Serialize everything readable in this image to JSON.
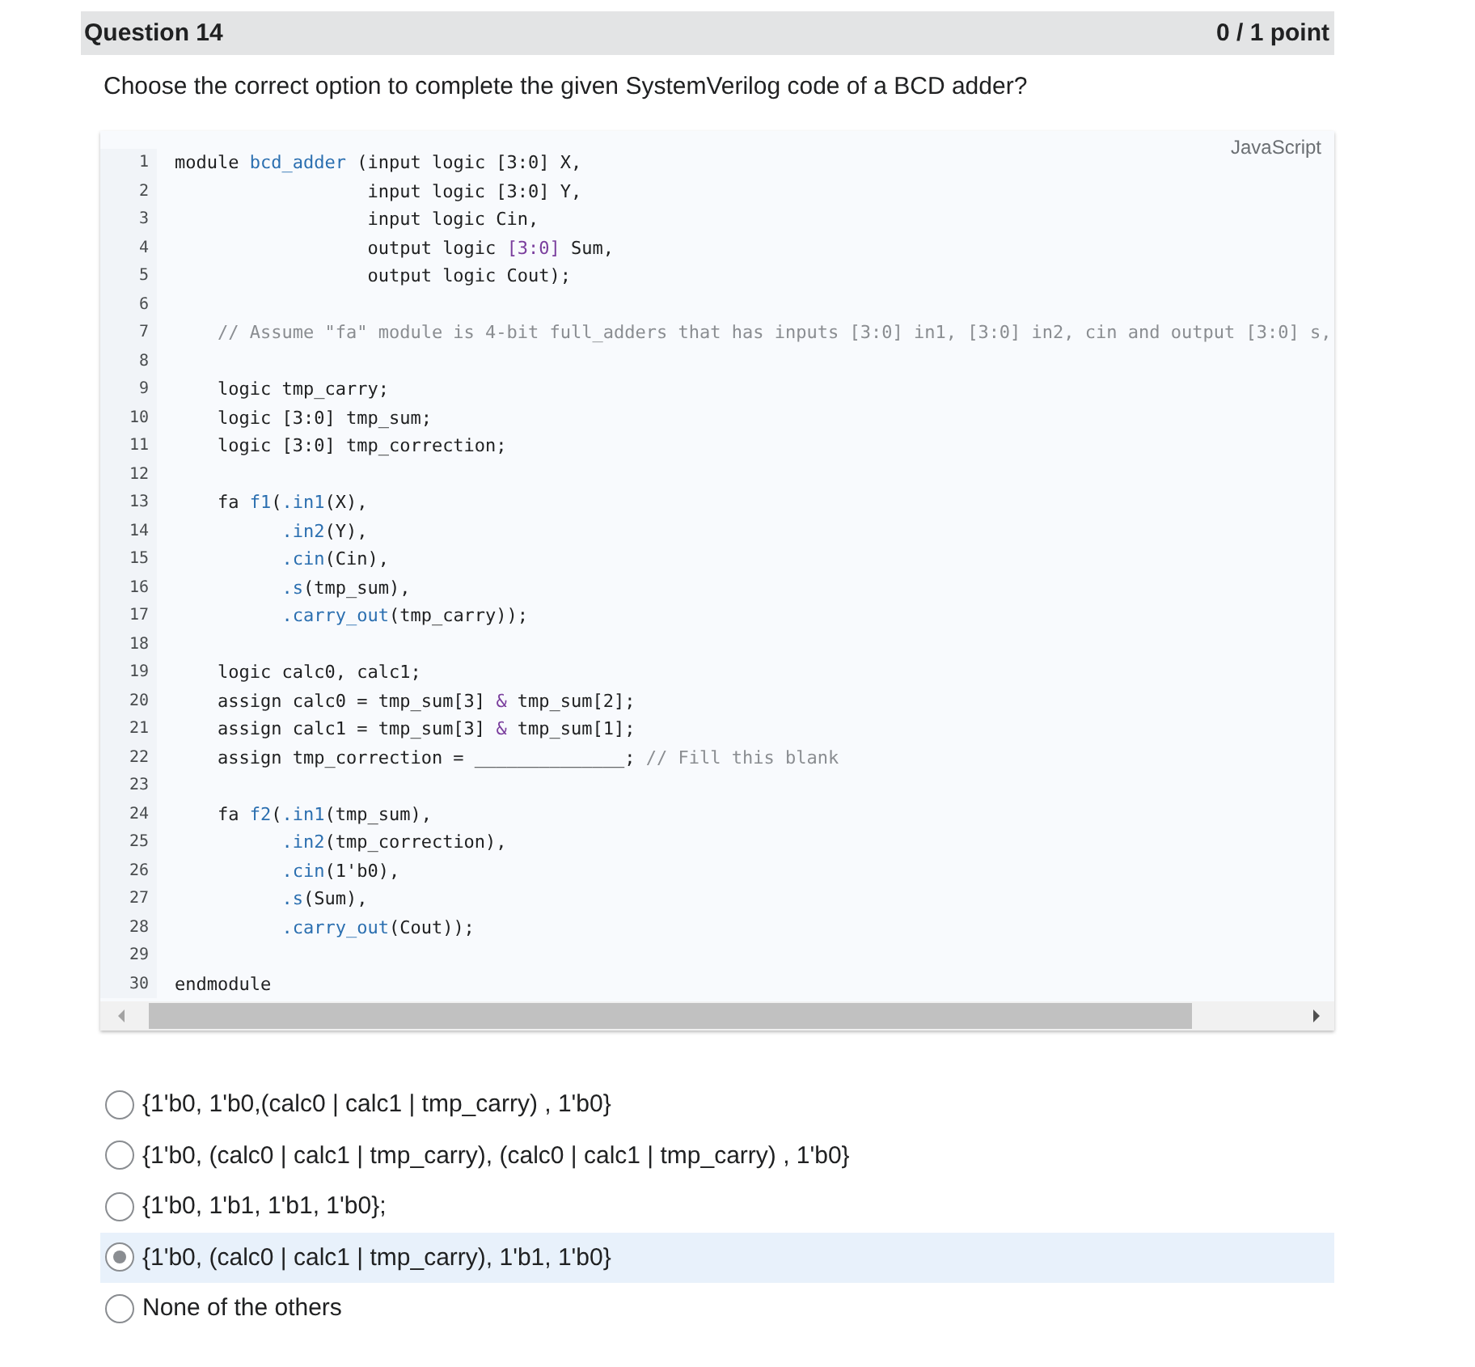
{
  "question": {
    "title": "Question 14",
    "score": "0 / 1 point",
    "prompt": "Choose the correct option to complete the given SystemVerilog code of a BCD adder?"
  },
  "code": {
    "language": "JavaScript",
    "lines": [
      {
        "number": "1",
        "tokens": [
          {
            "text": "module ",
            "kind": "plain"
          },
          {
            "text": "bcd_adder",
            "kind": "name"
          },
          {
            "text": " (input logic [3:0] X,",
            "kind": "plain"
          }
        ]
      },
      {
        "number": "2",
        "tokens": [
          {
            "text": "                  input logic [3:0] Y,",
            "kind": "plain"
          }
        ]
      },
      {
        "number": "3",
        "tokens": [
          {
            "text": "                  input logic Cin,",
            "kind": "plain"
          }
        ]
      },
      {
        "number": "4",
        "tokens": [
          {
            "text": "                  output logic ",
            "kind": "plain"
          },
          {
            "text": "[3:0]",
            "kind": "range"
          },
          {
            "text": " Sum,",
            "kind": "plain"
          }
        ]
      },
      {
        "number": "5",
        "tokens": [
          {
            "text": "                  output logic Cout);",
            "kind": "plain"
          }
        ]
      },
      {
        "number": "6"
      },
      {
        "number": "7",
        "tokens": [
          {
            "text": "    // Assume \"fa\" module is 4-bit full_adders that has inputs [3:0] in1, [3:0] in2, cin and output [3:0] s,",
            "kind": "comment"
          }
        ]
      },
      {
        "number": "8"
      },
      {
        "number": "9",
        "tokens": [
          {
            "text": "    logic tmp_carry;",
            "kind": "plain"
          }
        ]
      },
      {
        "number": "10",
        "tokens": [
          {
            "text": "    logic [3:0] tmp_sum;",
            "kind": "plain"
          }
        ]
      },
      {
        "number": "11",
        "tokens": [
          {
            "text": "    logic [3:0] tmp_correction;",
            "kind": "plain"
          }
        ]
      },
      {
        "number": "12"
      },
      {
        "number": "13",
        "tokens": [
          {
            "text": "    fa ",
            "kind": "plain"
          },
          {
            "text": "f1",
            "kind": "name"
          },
          {
            "text": "(",
            "kind": "plain"
          },
          {
            "text": ".in1",
            "kind": "name"
          },
          {
            "text": "(X),",
            "kind": "plain"
          }
        ]
      },
      {
        "number": "14",
        "tokens": [
          {
            "text": "          .in2",
            "kind": "name"
          },
          {
            "text": "(Y),",
            "kind": "plain"
          }
        ]
      },
      {
        "number": "15",
        "tokens": [
          {
            "text": "          .cin",
            "kind": "name"
          },
          {
            "text": "(Cin),",
            "kind": "plain"
          }
        ]
      },
      {
        "number": "16",
        "tokens": [
          {
            "text": "          .s",
            "kind": "name"
          },
          {
            "text": "(tmp_sum),",
            "kind": "plain"
          }
        ]
      },
      {
        "number": "17",
        "tokens": [
          {
            "text": "          .carry_out",
            "kind": "name"
          },
          {
            "text": "(tmp_carry));",
            "kind": "plain"
          }
        ]
      },
      {
        "number": "18"
      },
      {
        "number": "19",
        "tokens": [
          {
            "text": "    logic calc0, calc1;",
            "kind": "plain"
          }
        ]
      },
      {
        "number": "20",
        "tokens": [
          {
            "text": "    assign calc0 = tmp_sum[3] ",
            "kind": "plain"
          },
          {
            "text": "&",
            "kind": "range"
          },
          {
            "text": " tmp_sum[2];",
            "kind": "plain"
          }
        ]
      },
      {
        "number": "21",
        "tokens": [
          {
            "text": "    assign calc1 = tmp_sum[3] ",
            "kind": "plain"
          },
          {
            "text": "&",
            "kind": "range"
          },
          {
            "text": " tmp_sum[1];",
            "kind": "plain"
          }
        ]
      },
      {
        "number": "22",
        "tokens": [
          {
            "text": "    assign tmp_correction = ______________; ",
            "kind": "plain"
          },
          {
            "text": "// Fill this blank",
            "kind": "comment"
          }
        ]
      },
      {
        "number": "23"
      },
      {
        "number": "24",
        "tokens": [
          {
            "text": "    fa ",
            "kind": "plain"
          },
          {
            "text": "f2",
            "kind": "name"
          },
          {
            "text": "(",
            "kind": "plain"
          },
          {
            "text": ".in1",
            "kind": "name"
          },
          {
            "text": "(tmp_sum),",
            "kind": "plain"
          }
        ]
      },
      {
        "number": "25",
        "tokens": [
          {
            "text": "          .in2",
            "kind": "name"
          },
          {
            "text": "(tmp_correction),",
            "kind": "plain"
          }
        ]
      },
      {
        "number": "26",
        "tokens": [
          {
            "text": "          .cin",
            "kind": "name"
          },
          {
            "text": "(1'b0),",
            "kind": "plain"
          }
        ]
      },
      {
        "number": "27",
        "tokens": [
          {
            "text": "          .s",
            "kind": "name"
          },
          {
            "text": "(Sum),",
            "kind": "plain"
          }
        ]
      },
      {
        "number": "28",
        "tokens": [
          {
            "text": "          .carry_out",
            "kind": "name"
          },
          {
            "text": "(Cout));",
            "kind": "plain"
          }
        ]
      },
      {
        "number": "29"
      },
      {
        "number": "30",
        "tokens": [
          {
            "text": "endmodule",
            "kind": "plain"
          }
        ]
      }
    ]
  },
  "options": [
    {
      "label": "{1'b0, 1'b0,(calc0 | calc1 | tmp_carry) , 1'b0}",
      "selected": false
    },
    {
      "label": "{1'b0, (calc0 | calc1 | tmp_carry), (calc0 | calc1 | tmp_carry) , 1'b0}",
      "selected": false
    },
    {
      "label": "{1'b0, 1'b1, 1'b1, 1'b0};",
      "selected": false
    },
    {
      "label": "{1'b0, (calc0 | calc1 | tmp_carry), 1'b1, 1'b0}",
      "selected": true
    },
    {
      "label": "None of the others",
      "selected": false
    }
  ]
}
